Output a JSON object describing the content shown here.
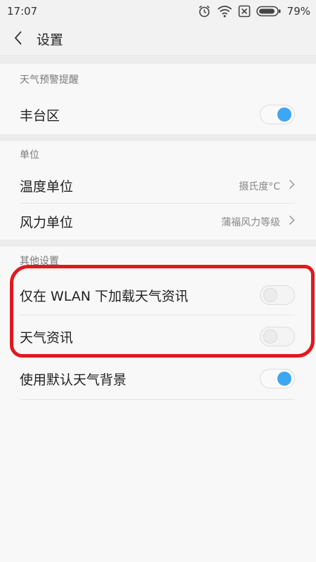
{
  "status_bar": {
    "time": "17:07",
    "battery": "79%",
    "icons": [
      "alarm-icon",
      "wifi-icon",
      "sim-off-icon",
      "battery-icon"
    ]
  },
  "header": {
    "back_icon": "chevron-left-icon",
    "title": "设置"
  },
  "sections": {
    "alerts": {
      "header": "天气预警提醒",
      "items": [
        {
          "label": "丰台区",
          "toggle": "on"
        }
      ]
    },
    "units": {
      "header": "单位",
      "items": [
        {
          "label": "温度单位",
          "value": "摄氏度°C"
        },
        {
          "label": "风力单位",
          "value": "蒲福风力等级"
        }
      ]
    },
    "other": {
      "header": "其他设置",
      "items": [
        {
          "label": "仅在 WLAN 下加载天气资讯",
          "toggle": "off"
        },
        {
          "label": "天气资讯",
          "toggle": "off"
        },
        {
          "label": "使用默认天气背景",
          "toggle": "on"
        }
      ]
    }
  },
  "colors": {
    "accent": "#3ea7f2",
    "annotation": "#e1191d"
  }
}
